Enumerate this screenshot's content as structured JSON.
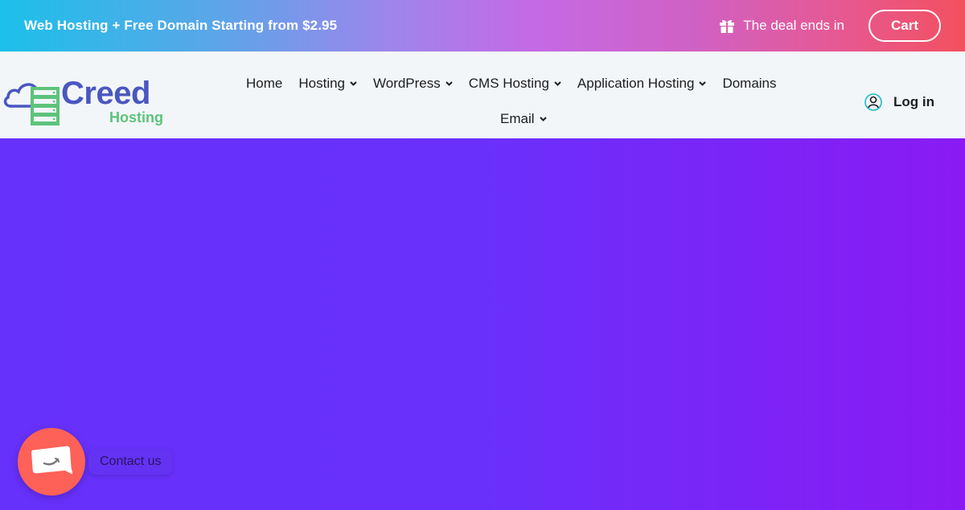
{
  "topbar": {
    "promo_text": "Web Hosting + Free Domain Starting from $2.95",
    "deal_icon": "gift-icon",
    "deal_text": "The deal ends in",
    "cart_label": "Cart"
  },
  "header": {
    "logo": {
      "brand": "Creed",
      "sub": "Hosting"
    },
    "nav": [
      {
        "label": "Home",
        "has_dropdown": false
      },
      {
        "label": "Hosting",
        "has_dropdown": true
      },
      {
        "label": "WordPress",
        "has_dropdown": true
      },
      {
        "label": "CMS Hosting",
        "has_dropdown": true
      },
      {
        "label": "Application Hosting",
        "has_dropdown": true
      },
      {
        "label": "Domains",
        "has_dropdown": false
      },
      {
        "label": "Email",
        "has_dropdown": true
      }
    ],
    "login": {
      "icon": "user-icon",
      "label": "Log in"
    }
  },
  "contact": {
    "icon": "chat-bubble-icon",
    "label": "Contact us"
  },
  "colors": {
    "brand_blue": "#4a57c0",
    "brand_green": "#5dc37a",
    "hero_purple": "#6a31fb",
    "contact_red": "#fe6157"
  }
}
